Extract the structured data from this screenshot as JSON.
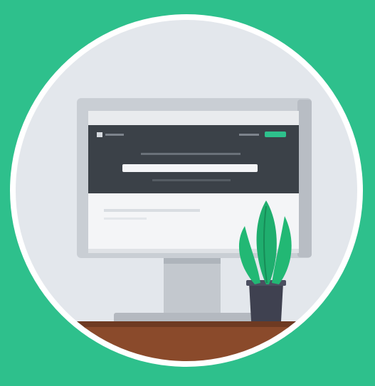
{
  "colors": {
    "background": "#2ec08c",
    "circle_fill": "#e3e7ec",
    "circle_ring": "#ffffff",
    "monitor_frame": "#c9ced4",
    "monitor_header": "#3b4148",
    "monitor_body": "#f4f5f7",
    "accent": "#2ec08c",
    "plant_leaf": "#1fae6e",
    "pot": "#3f4150",
    "desk": "#8a4a2b"
  },
  "icons": {
    "illustration": "desktop-monitor-with-plant-illustration"
  }
}
